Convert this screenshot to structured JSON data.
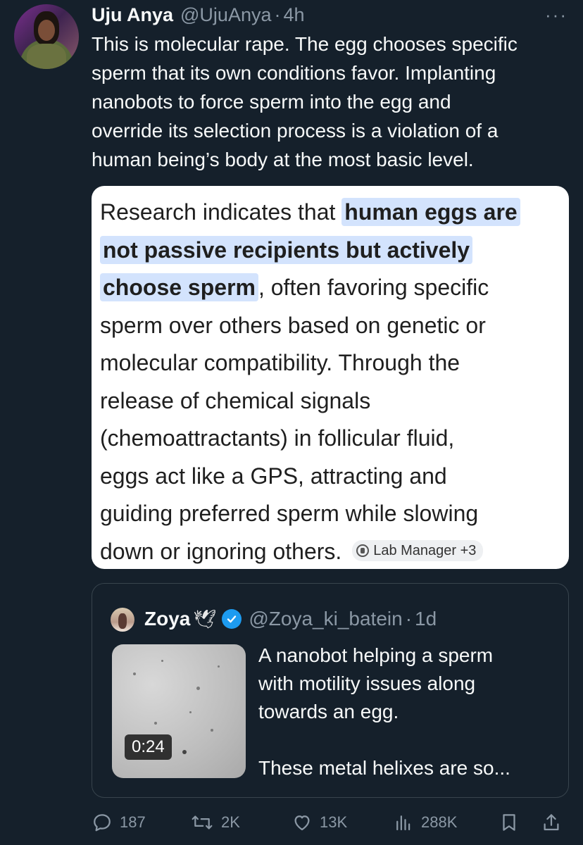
{
  "tweet": {
    "author_name": "Uju Anya",
    "author_handle": "@UjuAnya",
    "separator": "·",
    "time": "4h",
    "more_label": "···",
    "text_lines": [
      "This is molecular rape. The egg chooses specific",
      "sperm that its own conditions favor. Implanting",
      "nanobots to force sperm into the egg and",
      "override its selection process is a violation of a",
      "human being’s body at the most basic level."
    ]
  },
  "image_card": {
    "lead": "Research indicates that ",
    "highlight_1": "human eggs are",
    "highlight_2": "not passive recipients but actively",
    "highlight_3": "choose sperm",
    "rest_1": ", often favoring specific",
    "lines": [
      "sperm over others based on genetic or",
      "molecular compatibility. Through the",
      "release of chemical signals",
      "(chemoattractants) in follicular fluid,",
      "eggs act like a GPS, attracting and",
      "guiding preferred sperm while slowing"
    ],
    "last_line": "down or ignoring others. ",
    "source_chip": "Lab Manager +3"
  },
  "quote": {
    "name": "Zoya",
    "name_emoji": "🕊",
    "handle": "@Zoya_ki_batein",
    "separator": "·",
    "time": "1d",
    "video_duration": "0:24",
    "text_lines": [
      "A nanobot helping a sperm",
      "with motility issues along",
      "towards an egg."
    ],
    "text_after_gap": "These metal helixes are so..."
  },
  "actions": {
    "replies": "187",
    "reposts": "2K",
    "likes": "13K",
    "views": "288K",
    "icons": [
      "reply-icon",
      "repost-icon",
      "like-icon",
      "views-icon",
      "bookmark-icon",
      "share-icon"
    ]
  },
  "colors": {
    "background": "#15202b",
    "muted": "#8b98a5",
    "verified": "#1d9bf0",
    "highlight": "#d3e3fd"
  }
}
